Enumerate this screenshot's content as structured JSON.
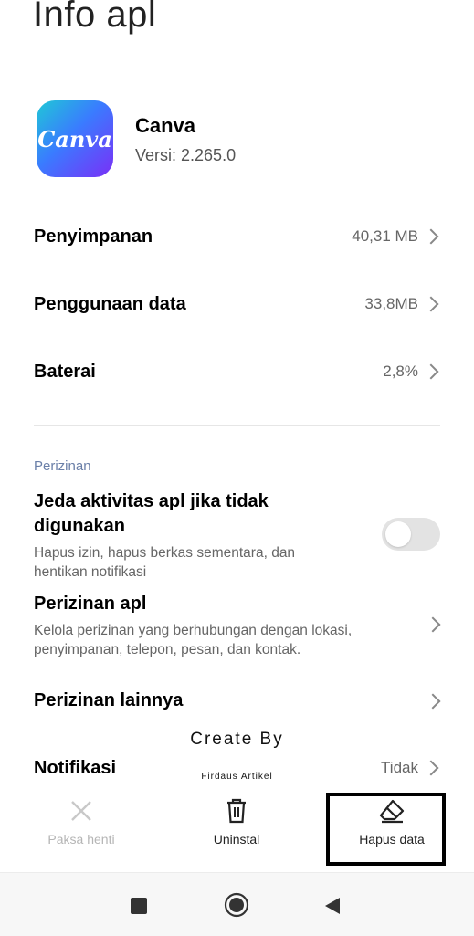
{
  "header": {
    "title": "Info apl"
  },
  "app": {
    "icon_text": "Canva",
    "name": "Canva",
    "version": "Versi: 2.265.0"
  },
  "info_rows": [
    {
      "label": "Penyimpanan",
      "value": "40,31 MB"
    },
    {
      "label": "Penggunaan data",
      "value": "33,8MB"
    },
    {
      "label": "Baterai",
      "value": "2,8%"
    }
  ],
  "permissions": {
    "section_title": "Perizinan",
    "pause": {
      "title": "Jeda aktivitas apl jika tidak digunakan",
      "description": "Hapus izin, hapus berkas sementara, dan hentikan notifikasi",
      "enabled": false
    },
    "app_perms": {
      "title": "Perizinan apl",
      "description": "Kelola perizinan yang berhubungan dengan lokasi, penyimpanan, telepon, pesan, dan kontak."
    },
    "other": {
      "title": "Perizinan lainnya"
    },
    "notifications": {
      "title": "Notifikasi",
      "value": "Tidak"
    }
  },
  "watermark": {
    "line1": "Create By",
    "line2": "Firdaus Artikel"
  },
  "actions": [
    {
      "label": "Paksa henti",
      "icon": "close-icon",
      "enabled": false
    },
    {
      "label": "Uninstal",
      "icon": "trash-icon",
      "enabled": true
    },
    {
      "label": "Hapus data",
      "icon": "eraser-icon",
      "enabled": true,
      "highlighted": true
    }
  ],
  "navbar": {
    "buttons": [
      "recents-button",
      "home-button",
      "back-button"
    ]
  }
}
